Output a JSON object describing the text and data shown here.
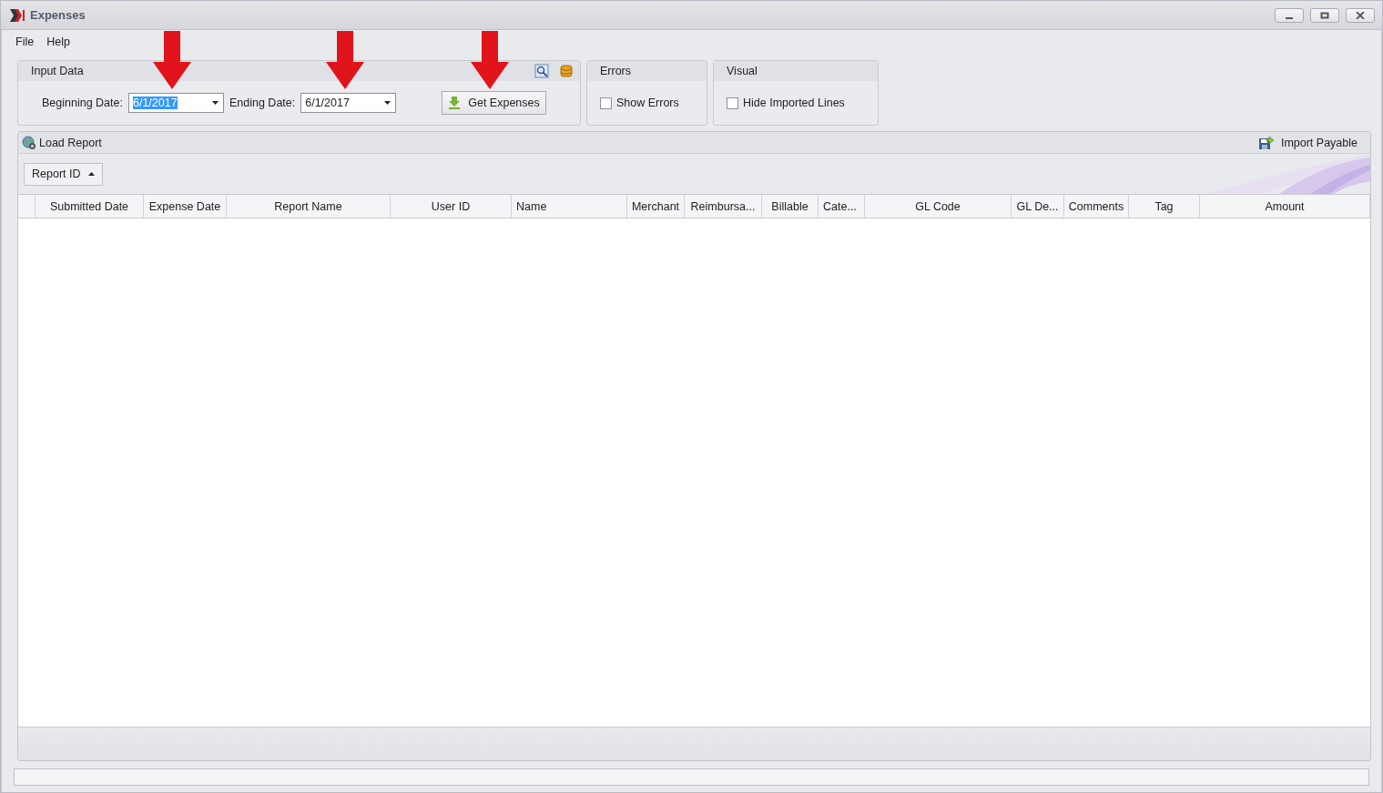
{
  "window": {
    "title": "Expenses"
  },
  "menu": [
    "File",
    "Help"
  ],
  "input_data": {
    "title": "Input Data",
    "fields": [
      {
        "label": "Beginning Date:",
        "value": "6/1/2017",
        "selected": true
      },
      {
        "label": "Ending Date:",
        "value": "6/1/2017",
        "selected": false
      }
    ],
    "button": "Get Expenses"
  },
  "errors": {
    "title": "Errors",
    "checkbox": {
      "label": "Show Errors",
      "checked": false
    }
  },
  "visual": {
    "title": "Visual",
    "checkbox": {
      "label": "Hide Imported Lines",
      "checked": false
    }
  },
  "report": {
    "title": "Load Report",
    "action": "Import Payable",
    "group_by": {
      "label": "Report ID",
      "sort_ascending": true
    },
    "columns": [
      {
        "label": "Submitted Date"
      },
      {
        "label": "Expense Date"
      },
      {
        "label": "Report Name"
      },
      {
        "label": "User ID"
      },
      {
        "label": "Name"
      },
      {
        "label": "Merchant"
      },
      {
        "label": "Reimbursa..."
      },
      {
        "label": "Billable"
      },
      {
        "label": "Cate..."
      },
      {
        "label": "GL Code"
      },
      {
        "label": "GL De..."
      },
      {
        "label": "Comments"
      },
      {
        "label": "Tag"
      },
      {
        "label": "Amount"
      }
    ]
  }
}
